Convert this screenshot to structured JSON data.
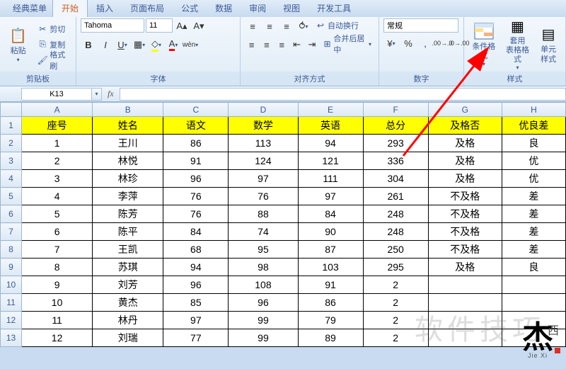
{
  "menu": {
    "classic": "经典菜单"
  },
  "tabs": [
    "开始",
    "插入",
    "页面布局",
    "公式",
    "数据",
    "审阅",
    "视图",
    "开发工具"
  ],
  "clipboard": {
    "group_label": "剪贴板",
    "paste_label": "粘贴",
    "cut_label": "剪切",
    "copy_label": "复制",
    "format_painter_label": "格式刷"
  },
  "font": {
    "group_label": "字体",
    "name": "Tahoma",
    "size": "11"
  },
  "alignment": {
    "group_label": "对齐方式",
    "wrap_label": "自动换行",
    "merge_label": "合并后居中"
  },
  "number": {
    "group_label": "数字",
    "format": "常规"
  },
  "styles": {
    "group_label": "样式",
    "conditional_format_label": "条件格式",
    "format_table_label": "套用",
    "format_table_label2": "表格格式",
    "cell_styles_label": "单元",
    "cell_styles_label2": "样式"
  },
  "namebox": {
    "cell_ref": "K13"
  },
  "chart_data": {
    "type": "table",
    "col_letters": [
      "A",
      "B",
      "C",
      "D",
      "E",
      "F",
      "G",
      "H"
    ],
    "headers": [
      "座号",
      "姓名",
      "语文",
      "数学",
      "英语",
      "总分",
      "及格否",
      "优良差"
    ],
    "rows": [
      [
        "1",
        "王川",
        "86",
        "113",
        "94",
        "293",
        "及格",
        "良"
      ],
      [
        "2",
        "林悦",
        "91",
        "124",
        "121",
        "336",
        "及格",
        "优"
      ],
      [
        "3",
        "林珍",
        "96",
        "97",
        "111",
        "304",
        "及格",
        "优"
      ],
      [
        "4",
        "李萍",
        "76",
        "76",
        "97",
        "261",
        "不及格",
        "差"
      ],
      [
        "5",
        "陈芳",
        "76",
        "88",
        "84",
        "248",
        "不及格",
        "差"
      ],
      [
        "6",
        "陈平",
        "84",
        "74",
        "90",
        "248",
        "不及格",
        "差"
      ],
      [
        "7",
        "王凯",
        "68",
        "95",
        "87",
        "250",
        "不及格",
        "差"
      ],
      [
        "8",
        "苏琪",
        "94",
        "98",
        "103",
        "295",
        "及格",
        "良"
      ],
      [
        "9",
        "刘芳",
        "96",
        "108",
        "91",
        "2",
        "",
        ""
      ],
      [
        "10",
        "黄杰",
        "85",
        "96",
        "86",
        "2",
        "",
        ""
      ],
      [
        "11",
        "林丹",
        "97",
        "99",
        "79",
        "2",
        "",
        ""
      ],
      [
        "12",
        "刘瑞",
        "77",
        "99",
        "89",
        "2",
        "",
        ""
      ]
    ]
  },
  "watermark": {
    "text": "软件技巧",
    "brand_big": "杰",
    "brand_small": "西",
    "brand_pinyin": "Jie Xi"
  }
}
